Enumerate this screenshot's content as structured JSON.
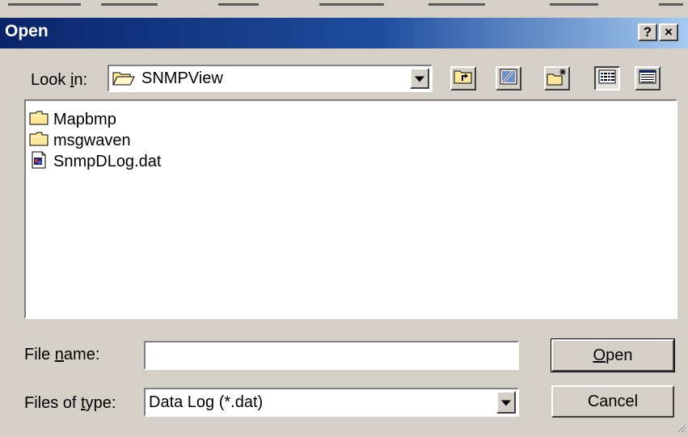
{
  "dialog": {
    "title": "Open",
    "help_label": "?",
    "close_label": "×"
  },
  "look_in": {
    "label_pre": "Look ",
    "label_ul": "i",
    "label_post": "n:",
    "value": "SNMPView"
  },
  "toolbar": {
    "icons": [
      "up-one-level-icon",
      "desktop-icon",
      "new-folder-icon",
      "list-view-icon",
      "details-view-icon"
    ]
  },
  "files": [
    {
      "name": "Mapbmp",
      "icon": "folder-icon"
    },
    {
      "name": "msgwaven",
      "icon": "folder-icon"
    },
    {
      "name": "SnmpDLog.dat",
      "icon": "data-file-icon"
    }
  ],
  "file_name": {
    "label_pre": "File ",
    "label_ul": "n",
    "label_post": "ame:",
    "value": ""
  },
  "file_type": {
    "label_pre": "Files of ",
    "label_ul": "t",
    "label_post": "ype:",
    "value": "Data Log (*.dat)"
  },
  "buttons": {
    "open_ul": "O",
    "open_rest": "pen",
    "cancel": "Cancel"
  },
  "colors": {
    "titlebar_start": "#0a246a",
    "titlebar_end": "#a6caf0",
    "face": "#d4d0c8",
    "folder": "#ffe89a"
  }
}
